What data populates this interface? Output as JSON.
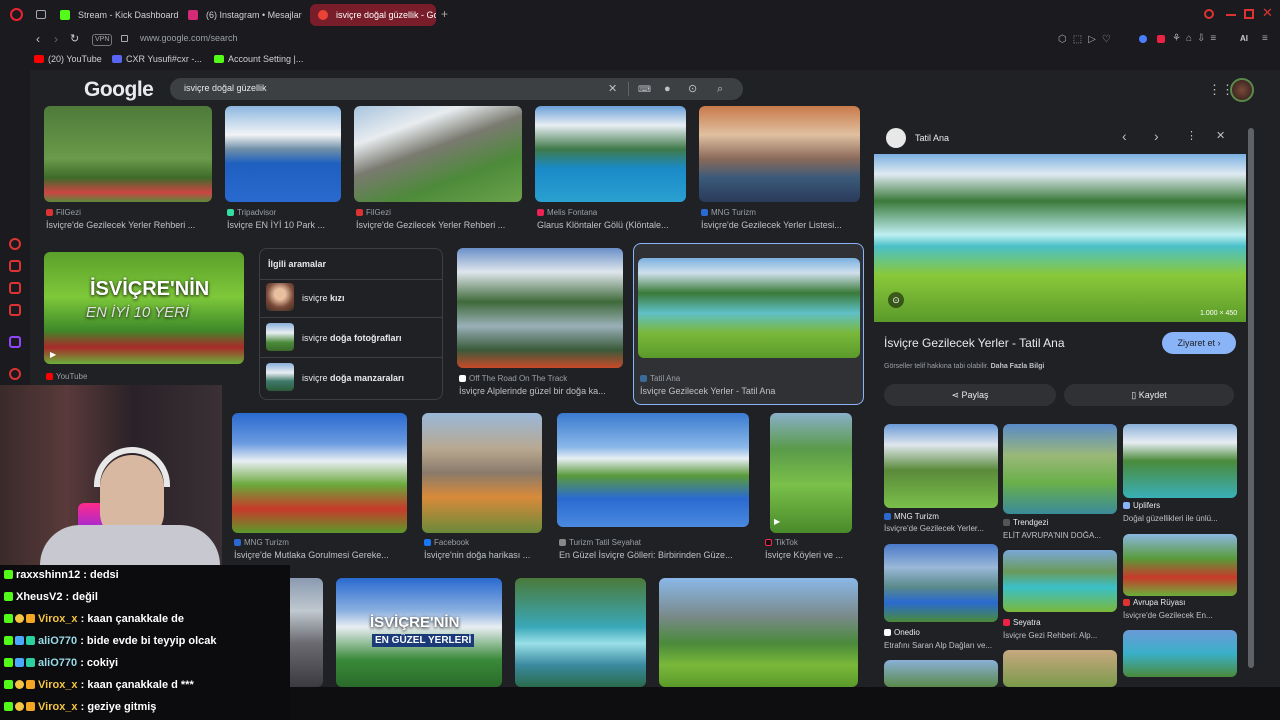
{
  "tabs": [
    {
      "label": "Stream - Kick Dashboard",
      "color": "#53fc18"
    },
    {
      "label": "(6) Instagram • Mesajlar",
      "color": "#d62976"
    },
    {
      "label": "isviçre doğal güzellik - Go",
      "color": "#ea4335"
    }
  ],
  "address": {
    "url": "www.google.com/search",
    "vpn": "VPN",
    "ai": "AI"
  },
  "bookmarks": [
    "(20) YouTube",
    "CXR Yusufi#cxr -...",
    "Account Setting |..."
  ],
  "google": {
    "logo": "Google",
    "query": "isviçre doğal güzellik"
  },
  "results_row1": [
    {
      "source": "FilGezi",
      "title": "İsviçre'de Gezilecek Yerler Rehberi ..."
    },
    {
      "source": "Tripadvisor",
      "title": "İsviçre EN İYİ 10 Park ..."
    },
    {
      "source": "FilGezi",
      "title": "İsviçre'de Gezilecek Yerler Rehberi ..."
    },
    {
      "source": "Melis Fontana",
      "title": "Glarus Klöntaler Gölü (Klöntale..."
    },
    {
      "source": "MNG Turizm",
      "title": "İsviçre'de Gezilecek Yerler Listesi..."
    }
  ],
  "youtube_thumb": {
    "text1": "İSVİÇRE'NİN",
    "text2": "EN İYİ 10 YERİ",
    "source": "YouTube"
  },
  "related": {
    "heading": "İlgili aramalar",
    "items": [
      {
        "pre": "isviçre ",
        "bold": "kızı"
      },
      {
        "pre": "isviçre ",
        "bold": "doğa fotoğrafları"
      },
      {
        "pre": "isviçre ",
        "bold": "doğa manzaraları"
      }
    ]
  },
  "results_row2": [
    {
      "source": "Off The Road On The Track",
      "title": "İsviçre Alplerinde güzel bir doğa ka..."
    },
    {
      "source": "Tatil Ana",
      "title": "İsviçre Gezilecek Yerler - Tatil Ana"
    }
  ],
  "results_row3": [
    {
      "source": "MNG Turizm",
      "title": "İsviçre'de Mutlaka Gorulmesi Gereke..."
    },
    {
      "source": "Facebook",
      "title": "İsviçre'nin doğa harikası ..."
    },
    {
      "source": "Turizm Tatil Seyahat",
      "title": "En Güzel İsviçre Gölleri: Birbirinden Güze..."
    },
    {
      "source": "TikTok",
      "title": "İsviçre Köyleri ve ..."
    }
  ],
  "row4_thumb": {
    "text1": "İSVİÇRE'NİN",
    "text2": "EN GÜZEL YERLERİ"
  },
  "panel": {
    "site": "Tatil Ana",
    "size": "1.000 × 450",
    "title": "İsviçre Gezilecek Yerler - Tatil Ana",
    "visit": "Ziyaret et",
    "copyright": "Görseller telif hakkına tabi olabilir.",
    "more_info": "Daha Fazla Bilgi",
    "share": "Paylaş",
    "save": "Kaydet",
    "similar": [
      {
        "source": "MNG Turizm",
        "title": "İsviçre'de Gezilecek Yerler..."
      },
      {
        "source": "Trendgezi",
        "title": "ELİT AVRUPA'NIN DOĞA..."
      },
      {
        "source": "Uplifers",
        "title": "Doğal güzellikleri ile ünlü..."
      },
      {
        "source": "Onedio",
        "title": "Etrafını Saran Alp Dağları ve..."
      },
      {
        "source": "Seyatra",
        "title": "İsviçre Gezi Rehberi: Alp..."
      },
      {
        "source": "Avrupa Rüyası",
        "title": "İsviçre'de Gezilecek En..."
      }
    ]
  },
  "chat": [
    {
      "user": "raxxshinn12",
      "msg": "dedsi",
      "color": "#ffffff"
    },
    {
      "user": "XheusV2",
      "msg": "değil",
      "color": "#ffffff"
    },
    {
      "user": "Virox_x",
      "msg": "kaan çanakkale de",
      "color": "#f5c542"
    },
    {
      "user": "aliO770",
      "msg": "bide evde bi teyyip olcak",
      "color": "#9adbe8"
    },
    {
      "user": "aliO770",
      "msg": "cokiyi",
      "color": "#9adbe8"
    },
    {
      "user": "Virox_x",
      "msg": "kaan çanakkale d ***",
      "color": "#f5c542"
    },
    {
      "user": "Virox_x",
      "msg": "geziye gitmiş",
      "color": "#f5c542"
    }
  ],
  "colors": {
    "accent": "#8ab4f8",
    "kick": "#53fc18",
    "active_tab": "#7a1d2a"
  }
}
